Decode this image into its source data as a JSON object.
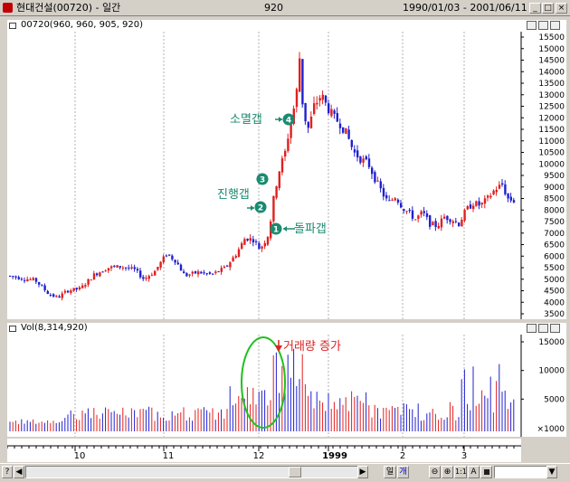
{
  "window": {
    "title": "현대건설(00720) - 일간",
    "code": "920",
    "date_range": "1990/01/03 - 2001/06/11"
  },
  "price_pane": {
    "header": "00720(960, 960, 905, 920)",
    "y_ticks": [
      "15500",
      "15000",
      "14500",
      "14000",
      "13500",
      "13000",
      "12500",
      "12000",
      "11500",
      "11000",
      "10500",
      "10000",
      "9500",
      "9000",
      "8500",
      "8000",
      "7500",
      "7000",
      "6500",
      "6000",
      "5500",
      "5000",
      "4500",
      "4000",
      "3500"
    ],
    "annotations": {
      "extinction_gap": "소멸갭",
      "progress_gap": "진행갭",
      "breakaway_gap": "돌파갭",
      "n1": "1",
      "n2": "2",
      "n3": "3",
      "n4": "4"
    }
  },
  "volume_pane": {
    "header": "Vol(8,314,920)",
    "y_ticks": [
      "15000",
      "10000",
      "5000"
    ],
    "scale": "×1000",
    "annotation": "거래량 증가"
  },
  "x_axis": {
    "labels": [
      "10",
      "11",
      "12",
      "1999",
      "2",
      "3"
    ]
  },
  "toolbar": {
    "period_day": "일",
    "period_month": "개",
    "zoom_in": "⊕",
    "ratio": "1:1",
    "text_tool": "A",
    "help": "?"
  },
  "colors": {
    "up": "#e02020",
    "down": "#2020d0",
    "annotation_green": "#1a8a70",
    "ellipse_green": "#20c020",
    "volume_red": "#e02020"
  }
}
